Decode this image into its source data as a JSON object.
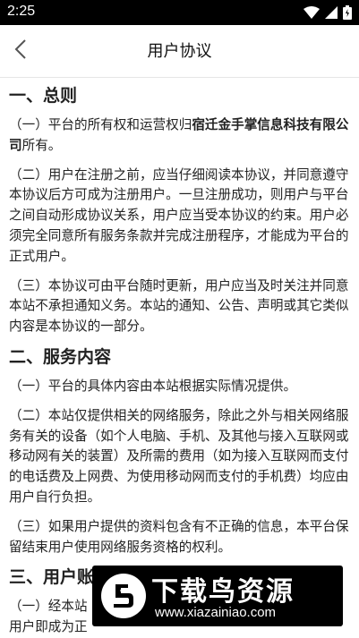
{
  "status_bar": {
    "time": "2:25",
    "icons": [
      "wifi-icon",
      "signal-icon",
      "battery-icon"
    ]
  },
  "header": {
    "back_icon": "chevron-left-icon",
    "title": "用户协议"
  },
  "agreement": {
    "section1": {
      "title": "一、总则",
      "p1_prefix": "（一）平台的所有权和运营权归",
      "p1_company": "宿迁金手掌信息科技有限公司",
      "p1_suffix": "所有。",
      "p2": "（二）用户在注册之前，应当仔细阅读本协议，并同意遵守本协议后方可成为注册用户。一旦注册成功，则用户与平台之间自动形成协议关系，用户应当受本协议的约束。用户必须完全同意所有服务条款并完成注册程序，才能成为平台的正式用户。",
      "p3": "（三）本协议可由平台随时更新，用户应当及时关注并同意本站不承担通知义务。本站的通知、公告、声明或其它类似内容是本协议的一部分。"
    },
    "section2": {
      "title": "二、服务内容",
      "p1": "（一）平台的具体内容由本站根据实际情况提供。",
      "p2": "（二）本站仅提供相关的网络服务，除此之外与相关网络服务有关的设备（如个人电脑、手机、及其他与接入互联网或移动网有关的装置）及所需的费用（如为接入互联网而支付的电话费及上网费、为使用移动网而支付的手机费）均应由用户自行负担。",
      "p3": "（三）如果用户提供的资料包含有不正确的信息，本平台保留结束用户使用网络服务资格的权利。"
    },
    "section3": {
      "title": "三、用户账",
      "p1": "（一）经本站",
      "p2": "用户即成为正"
    }
  },
  "watermark": {
    "text": "下载鸟资源",
    "url": "www.xiazainiao.com"
  }
}
